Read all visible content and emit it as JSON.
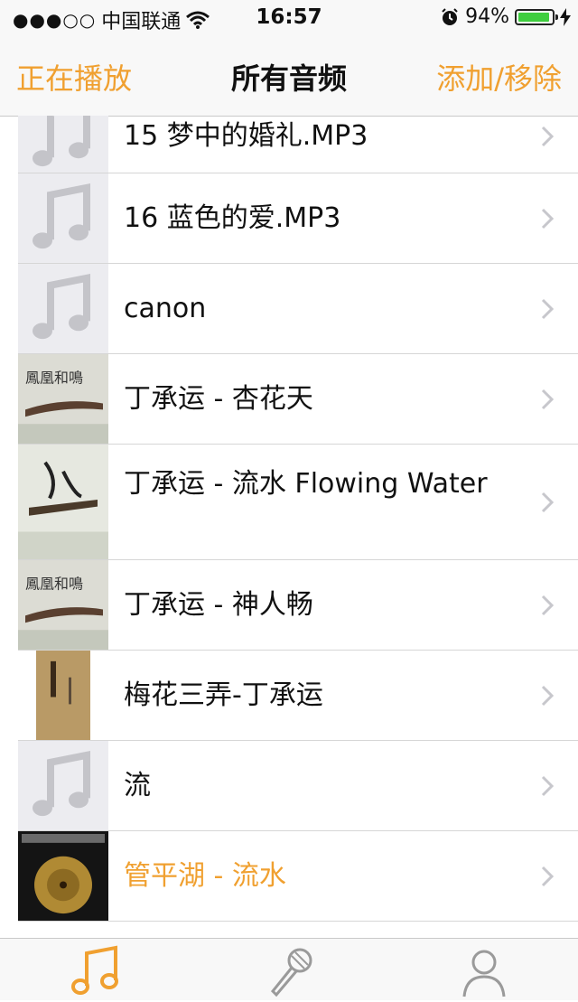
{
  "status_bar": {
    "signal": "●●●○○",
    "carrier": "中国联通",
    "time": "16:57",
    "battery_percent": "94%",
    "battery_level": 0.94
  },
  "nav": {
    "left_button": "正在播放",
    "title": "所有音频",
    "right_button": "添加/移除"
  },
  "colors": {
    "accent": "#f0a030",
    "placeholder_bg": "#ececf0",
    "note_gray": "#c4c4c9"
  },
  "songs": [
    {
      "title": "15 梦中的婚礼.MP3",
      "art": "note-placeholder"
    },
    {
      "title": "16 蓝色的爱.MP3",
      "art": "note-placeholder"
    },
    {
      "title": "canon",
      "art": "note-placeholder"
    },
    {
      "title": "丁承运 - 杏花天",
      "art": "album-guqin-cover"
    },
    {
      "title": "丁承运 - 流水 Flowing Water",
      "art": "album-calligraphy-cover"
    },
    {
      "title": "丁承运 - 神人畅",
      "art": "album-guqin-cover"
    },
    {
      "title": "梅花三弄-丁承运",
      "art": "album-scroll-cover"
    },
    {
      "title": "流",
      "art": "note-placeholder"
    },
    {
      "title": "管平湖 - 流水",
      "art": "album-golden-record-cover",
      "playing": true
    }
  ],
  "tabs": [
    {
      "icon": "music-note-icon",
      "active": true
    },
    {
      "icon": "microphone-icon",
      "active": false
    },
    {
      "icon": "person-icon",
      "active": false
    }
  ]
}
